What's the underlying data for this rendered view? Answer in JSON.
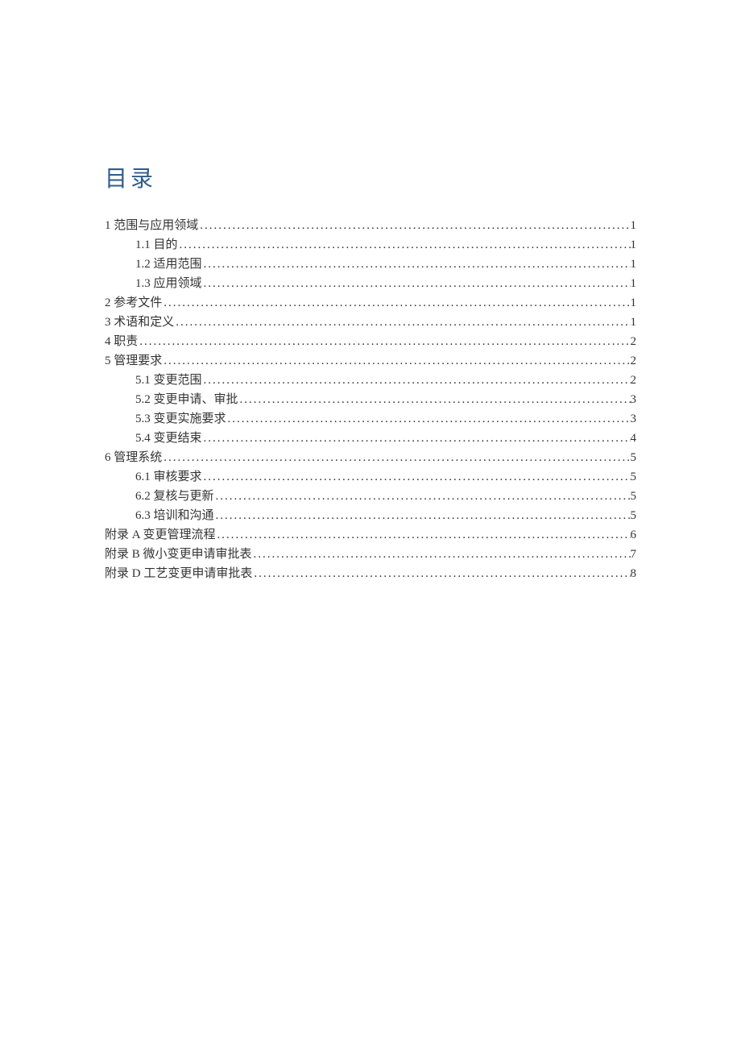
{
  "title": "目录",
  "entries": [
    {
      "label": "1  范围与应用领域",
      "page": "1",
      "indent": false
    },
    {
      "label": "1.1 目的",
      "page": "1",
      "indent": true
    },
    {
      "label": "1.2 适用范围",
      "page": "1",
      "indent": true
    },
    {
      "label": "1.3 应用领域",
      "page": "1",
      "indent": true
    },
    {
      "label": "2  参考文件",
      "page": "1",
      "indent": false
    },
    {
      "label": "3  术语和定义",
      "page": "1",
      "indent": false
    },
    {
      "label": "4  职责",
      "page": "2",
      "indent": false
    },
    {
      "label": "5  管理要求",
      "page": "2",
      "indent": false
    },
    {
      "label": "5.1 变更范围",
      "page": "2",
      "indent": true
    },
    {
      "label": "5.2 变更申请、审批",
      "page": "3",
      "indent": true
    },
    {
      "label": "5.3 变更实施要求",
      "page": "3",
      "indent": true
    },
    {
      "label": "5.4 变更结束",
      "page": "4",
      "indent": true
    },
    {
      "label": "6 管理系统",
      "page": "5",
      "indent": false
    },
    {
      "label": "6.1 审核要求",
      "page": "5",
      "indent": true
    },
    {
      "label": "6.2 复核与更新",
      "page": "5",
      "indent": true
    },
    {
      "label": "6.3 培训和沟通",
      "page": "5",
      "indent": true
    },
    {
      "label": "附录 A   变更管理流程",
      "page": "6",
      "indent": false
    },
    {
      "label": "附录 B  微小变更申请审批表",
      "page": "7",
      "indent": false
    },
    {
      "label": "附录 D   工艺变更申请审批表",
      "page": "8",
      "indent": false
    }
  ]
}
